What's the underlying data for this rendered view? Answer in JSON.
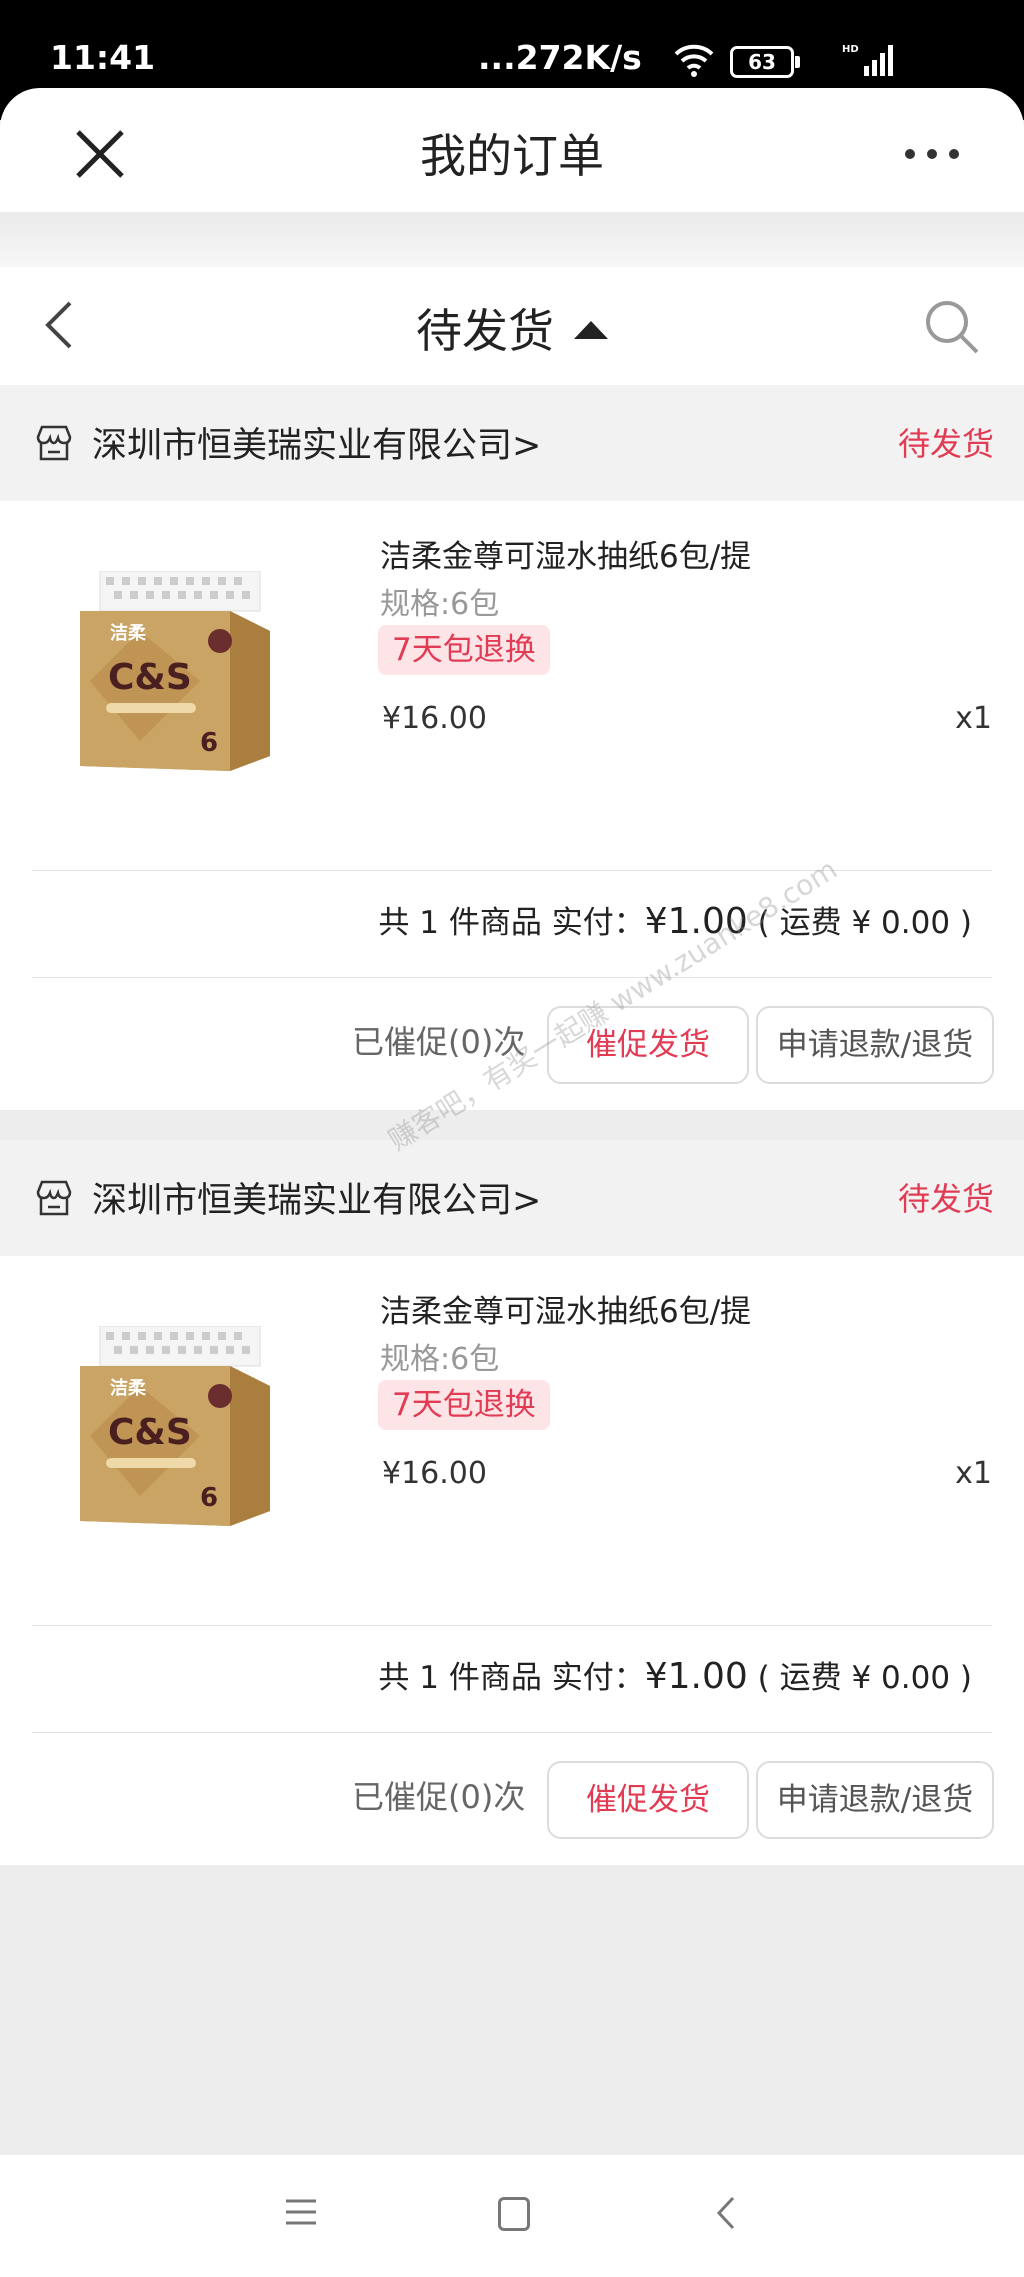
{
  "status_bar": {
    "time": "11:41",
    "network_speed": "...272K/s",
    "battery": "63"
  },
  "header": {
    "title": "我的订单"
  },
  "filter": {
    "label": "待发货"
  },
  "watermark": "赚客吧，有奖一起赚 www.zuanke8.com",
  "orders": [
    {
      "store": "深圳市恒美瑞实业有限公司>",
      "status": "待发货",
      "product_name": "洁柔金尊可湿水抽纸6包/提",
      "spec": "规格:6包",
      "tag": "7天包退换",
      "price": "¥16.00",
      "qty": "x1",
      "summary_prefix": "共 1 件商品  实付：",
      "summary_amount": "¥1.00",
      "summary_shipping": "( 运费 ¥ 0.00 )",
      "urge_count": "已催促(0)次",
      "urge_button": "催促发货",
      "refund_button": "申请退款/退货"
    },
    {
      "store": "深圳市恒美瑞实业有限公司>",
      "status": "待发货",
      "product_name": "洁柔金尊可湿水抽纸6包/提",
      "spec": "规格:6包",
      "tag": "7天包退换",
      "price": "¥16.00",
      "qty": "x1",
      "summary_prefix": "共 1 件商品  实付：",
      "summary_amount": "¥1.00",
      "summary_shipping": "( 运费 ¥ 0.00 )",
      "urge_count": "已催促(0)次",
      "urge_button": "催促发货",
      "refund_button": "申请退款/退货"
    }
  ],
  "product_image": {
    "brand_text": "C&S",
    "logo_text": "洁柔"
  },
  "colors": {
    "accent_red": "#e23c55",
    "tag_bg": "#fde4e7"
  }
}
